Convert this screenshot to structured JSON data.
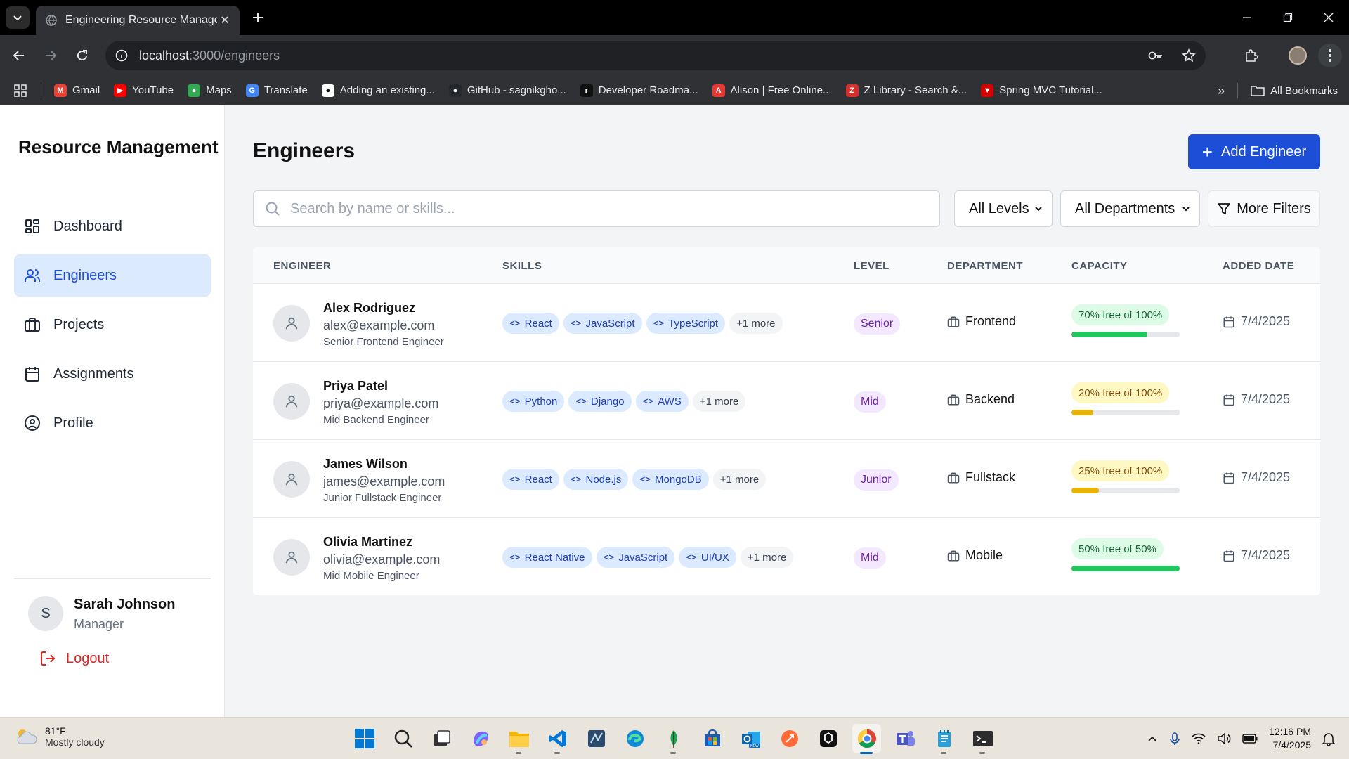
{
  "browser": {
    "tab_title": "Engineering Resource Management",
    "url_host": "localhost",
    "url_path": ":3000/engineers",
    "bookmarks": [
      {
        "label": "Gmail",
        "color": "#ea4335",
        "glyph": "M"
      },
      {
        "label": "YouTube",
        "color": "#ff0000",
        "glyph": "▶"
      },
      {
        "label": "Maps",
        "color": "#34a853",
        "glyph": "●"
      },
      {
        "label": "Translate",
        "color": "#4285f4",
        "glyph": "G"
      },
      {
        "label": "Adding an existing...",
        "color": "#ffffff",
        "glyph": "●"
      },
      {
        "label": "GitHub - sagnikgho...",
        "color": "#24292e",
        "glyph": "●"
      },
      {
        "label": "Developer Roadma...",
        "color": "#111111",
        "glyph": "r"
      },
      {
        "label": "Alison | Free Online...",
        "color": "#e53935",
        "glyph": "A"
      },
      {
        "label": "Z Library - Search &...",
        "color": "#d32f2f",
        "glyph": "Z"
      },
      {
        "label": "Spring MVC Tutorial...",
        "color": "#d50000",
        "glyph": "▼"
      }
    ],
    "all_bookmarks": "All Bookmarks"
  },
  "sidebar": {
    "brand": "Resource Management",
    "items": [
      {
        "label": "Dashboard",
        "icon": "dashboard-icon"
      },
      {
        "label": "Engineers",
        "icon": "users-icon"
      },
      {
        "label": "Projects",
        "icon": "briefcase-icon"
      },
      {
        "label": "Assignments",
        "icon": "calendar-icon"
      },
      {
        "label": "Profile",
        "icon": "user-circle-icon"
      }
    ],
    "active_item": "Engineers",
    "user": {
      "initial": "S",
      "name": "Sarah Johnson",
      "role": "Manager"
    },
    "logout_label": "Logout"
  },
  "main": {
    "title": "Engineers",
    "add_button": "Add Engineer",
    "search_placeholder": "Search by name or skills...",
    "level_filter": "All Levels",
    "department_filter": "All Departments",
    "more_filters": "More Filters",
    "columns": [
      "ENGINEER",
      "SKILLS",
      "LEVEL",
      "DEPARTMENT",
      "CAPACITY",
      "ADDED DATE"
    ],
    "rows": [
      {
        "name": "Alex Rodriguez",
        "email": "alex@example.com",
        "title": "Senior Frontend Engineer",
        "skills": [
          "React",
          "JavaScript",
          "TypeScript"
        ],
        "more": "+1 more",
        "level": "Senior",
        "department": "Frontend",
        "capacity_label": "70% free of 100%",
        "capacity_free": 0.7,
        "capacity_color": "green",
        "date": "7/4/2025"
      },
      {
        "name": "Priya Patel",
        "email": "priya@example.com",
        "title": "Mid Backend Engineer",
        "skills": [
          "Python",
          "Django",
          "AWS"
        ],
        "more": "+1 more",
        "level": "Mid",
        "department": "Backend",
        "capacity_label": "20% free of 100%",
        "capacity_free": 0.2,
        "capacity_color": "yellow",
        "date": "7/4/2025"
      },
      {
        "name": "James Wilson",
        "email": "james@example.com",
        "title": "Junior Fullstack Engineer",
        "skills": [
          "React",
          "Node.js",
          "MongoDB"
        ],
        "more": "+1 more",
        "level": "Junior",
        "department": "Fullstack",
        "capacity_label": "25% free of 100%",
        "capacity_free": 0.25,
        "capacity_color": "yellow",
        "date": "7/4/2025"
      },
      {
        "name": "Olivia Martinez",
        "email": "olivia@example.com",
        "title": "Mid Mobile Engineer",
        "skills": [
          "React Native",
          "JavaScript",
          "UI/UX"
        ],
        "more": "+1 more",
        "level": "Mid",
        "department": "Mobile",
        "capacity_label": "50% free of 50%",
        "capacity_free": 1.0,
        "capacity_color": "green",
        "date": "7/4/2025"
      }
    ]
  },
  "taskbar": {
    "weather_temp": "81°F",
    "weather_desc": "Mostly cloudy",
    "time": "12:16 PM",
    "date": "7/4/2025"
  },
  "colors": {
    "accent": "#1d4ed8",
    "green": "#22c55e",
    "yellow": "#eab308"
  }
}
